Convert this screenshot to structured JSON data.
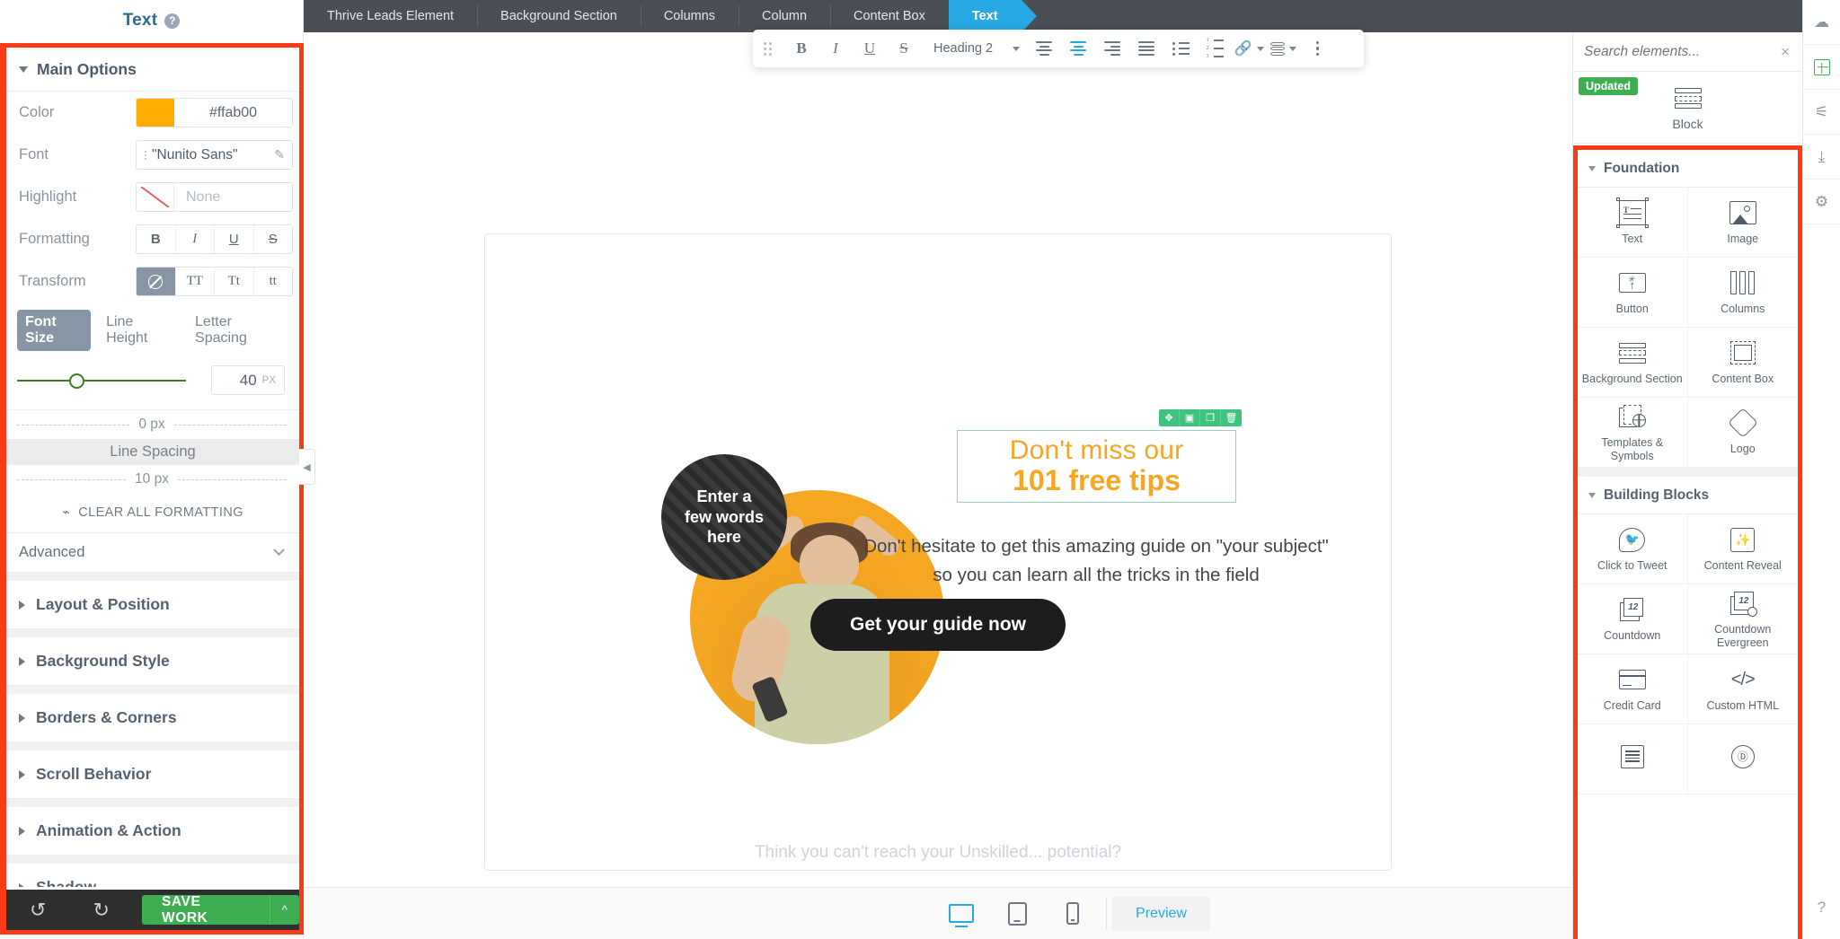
{
  "left_panel": {
    "title": "Text",
    "help_icon": "?",
    "main_options": {
      "heading": "Main Options",
      "rows": [
        {
          "label": "Color",
          "value": "#ffab00",
          "swatch": "#ffab00"
        },
        {
          "label": "Font",
          "value": "\"Nunito Sans\""
        },
        {
          "label": "Highlight",
          "value": "None"
        }
      ],
      "formatting": {
        "label": "Formatting",
        "buttons": [
          "B",
          "I",
          "U",
          "S"
        ]
      },
      "transform": {
        "label": "Transform",
        "buttons": [
          "none",
          "TT",
          "Tt",
          "tt"
        ],
        "active": "none"
      },
      "size_tabs": [
        {
          "label": "Font Size",
          "active": true
        },
        {
          "label": "Line Height",
          "active": false
        },
        {
          "label": "Letter Spacing",
          "active": false
        }
      ],
      "font_size": {
        "value": "40",
        "unit": "PX"
      },
      "margin_top": "0 px",
      "line_spacing_label": "Line Spacing",
      "margin_bottom": "10 px",
      "clear_formatting": "CLEAR ALL FORMATTING",
      "advanced": "Advanced"
    },
    "sections": [
      "Layout & Position",
      "Background Style",
      "Borders & Corners",
      "Scroll Behavior",
      "Animation & Action",
      "Shadow"
    ],
    "save_bar": {
      "undo_icon": "undo-icon",
      "redo_icon": "redo-icon",
      "save_label": "SAVE WORK",
      "caret": "^",
      "save_color": "#3fae53"
    }
  },
  "breadcrumb": {
    "items": [
      {
        "label": "Thrive Leads Element",
        "selected": false
      },
      {
        "label": "Background Section",
        "selected": false
      },
      {
        "label": "Columns",
        "selected": false
      },
      {
        "label": "Column",
        "selected": false
      },
      {
        "label": "Content Box",
        "selected": false
      },
      {
        "label": "Text",
        "selected": true
      }
    ],
    "accent": "#27a9e3"
  },
  "editor_toolbar": {
    "bold": "B",
    "italic": "I",
    "underline": "U",
    "strike": "S",
    "block_format": "Heading 2",
    "align_left": "align-left-icon",
    "align_center": "align-center-icon",
    "align_right": "align-right-icon",
    "align_justify": "align-justify-icon",
    "bullet_list": "bullet-list-icon",
    "number_list": "numbered-list-icon",
    "link": "link-icon",
    "dynamic_data": "database-icon",
    "more": "more-options-icon"
  },
  "canvas": {
    "badge_text_line1": "Enter a",
    "badge_text_line2": "few words",
    "badge_text_line3": "here",
    "heading_line1": "Don't miss our",
    "heading_line2": "101 free tips",
    "heading_color": "#f5a623",
    "body_line1": "Don't hesitate to get this amazing guide on \"your subject\"",
    "body_line2": "so you can learn all the tricks in the field",
    "cta_label": "Get your guide now",
    "element_toolbar": [
      "move-icon",
      "save-icon",
      "duplicate-icon",
      "delete-icon"
    ],
    "element_toolbar_color": "#3fc47f",
    "lower_hint": "Think you can't reach your Unskilled... potential?"
  },
  "bottom_bar": {
    "desktop": "desktop-icon",
    "tablet": "tablet-icon",
    "mobile": "mobile-icon",
    "preview": "Preview"
  },
  "right_panel": {
    "search_placeholder": "Search elements...",
    "search_value": "",
    "clear_icon": "×",
    "promo": {
      "badge": "Updated",
      "label": "Block"
    },
    "groups": [
      {
        "title": "Foundation",
        "items": [
          {
            "label": "Text",
            "icon": "text-element-icon"
          },
          {
            "label": "Image",
            "icon": "image-element-icon"
          },
          {
            "label": "Button",
            "icon": "button-element-icon"
          },
          {
            "label": "Columns",
            "icon": "columns-element-icon"
          },
          {
            "label": "Background Section",
            "icon": "background-section-icon"
          },
          {
            "label": "Content Box",
            "icon": "content-box-icon"
          },
          {
            "label": "Templates & Symbols",
            "icon": "templates-symbols-icon"
          },
          {
            "label": "Logo",
            "icon": "logo-icon"
          }
        ]
      },
      {
        "title": "Building Blocks",
        "items": [
          {
            "label": "Click to Tweet",
            "icon": "twitter-icon"
          },
          {
            "label": "Content Reveal",
            "icon": "magic-wand-icon"
          },
          {
            "label": "Countdown",
            "icon": "countdown-icon"
          },
          {
            "label": "Countdown Evergreen",
            "icon": "countdown-evergreen-icon"
          },
          {
            "label": "Credit Card",
            "icon": "credit-card-icon"
          },
          {
            "label": "Custom HTML",
            "icon": "code-icon"
          },
          {
            "label": "",
            "icon": "lines-icon"
          },
          {
            "label": "",
            "icon": "disc-icon"
          }
        ]
      }
    ],
    "highlight_color": "#fb3b15"
  },
  "right_strip": {
    "icons": [
      "cloud-upload-icon",
      "add-element-icon",
      "settings-sliders-icon",
      "import-icon",
      "gear-icon",
      "help-icon"
    ]
  }
}
